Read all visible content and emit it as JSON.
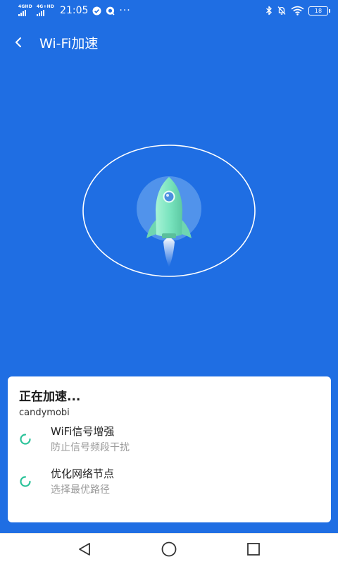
{
  "status_bar": {
    "time": "21:05",
    "network_1": "4GHD",
    "network_2": "4G+HD",
    "more": "···",
    "battery": "18"
  },
  "header": {
    "title": "Wi-Fi加速"
  },
  "card": {
    "status": "正在加速...",
    "ssid": "candymobi",
    "tasks": [
      {
        "title": "WiFi信号增强",
        "subtitle": "防止信号频段干扰"
      },
      {
        "title": "优化网络节点",
        "subtitle": "选择最优路径"
      }
    ]
  },
  "colors": {
    "background": "#1f6ee3",
    "spinner": "#2cc39a",
    "rocket": "#7fe8c4"
  },
  "icons": {
    "back": "chevron-left-icon",
    "bluetooth": "bluetooth-icon",
    "mute": "bell-off-icon",
    "wifi": "wifi-icon",
    "rocket": "rocket-icon",
    "nav_back": "triangle-back-icon",
    "nav_home": "circle-home-icon",
    "nav_recent": "square-recent-icon"
  }
}
